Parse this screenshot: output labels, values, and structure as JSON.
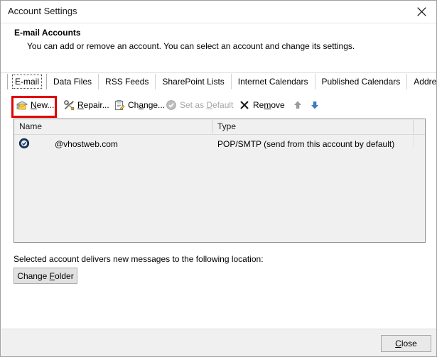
{
  "window": {
    "title": "Account Settings",
    "close_icon": "close-icon"
  },
  "header": {
    "title": "E-mail Accounts",
    "description": "You can add or remove an account. You can select an account and change its settings."
  },
  "tabs": [
    {
      "label": "E-mail",
      "selected": true
    },
    {
      "label": "Data Files",
      "selected": false
    },
    {
      "label": "RSS Feeds",
      "selected": false
    },
    {
      "label": "SharePoint Lists",
      "selected": false
    },
    {
      "label": "Internet Calendars",
      "selected": false
    },
    {
      "label": "Published Calendars",
      "selected": false
    },
    {
      "label": "Address Books",
      "selected": false
    }
  ],
  "toolbar": {
    "new_label": "New...",
    "repair_label": "Repair...",
    "change_label": "Change...",
    "set_default_label": "Set as Default",
    "remove_label": "Remove",
    "move_up_icon": "arrow-up-icon",
    "move_down_icon": "arrow-down-icon",
    "highlight_color": "#e00000",
    "disabled_color": "#a6a6a6",
    "arrow_up_color": "#9a9a9a",
    "arrow_down_color": "#2f6fba"
  },
  "accounts_list": {
    "columns": [
      "Name",
      "Type"
    ],
    "rows": [
      {
        "icon": "account-default-icon",
        "name": "@vhostweb.com",
        "type": "POP/SMTP (send from this account by default)"
      }
    ]
  },
  "delivery": {
    "label": "Selected account delivers new messages to the following location:",
    "change_folder_label": "Change Folder"
  },
  "footer": {
    "close_label": "Close"
  }
}
